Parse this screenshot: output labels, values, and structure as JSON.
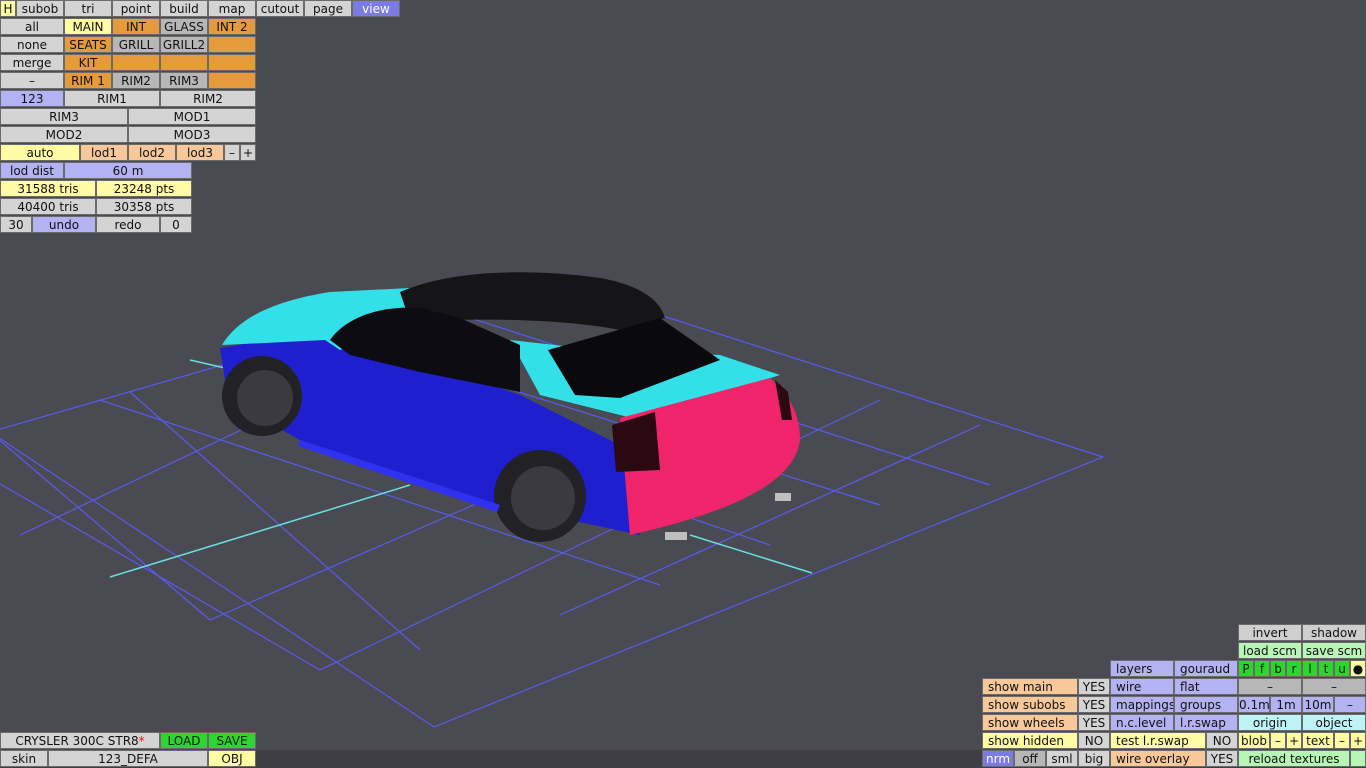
{
  "menu": {
    "h": "H",
    "subob": "subob",
    "tri": "tri",
    "point": "point",
    "build": "build",
    "map": "map",
    "cutout": "cutout",
    "page": "page",
    "view": "view"
  },
  "sel": {
    "all": "all",
    "none": "none",
    "merge": "merge",
    "minus": "–"
  },
  "parts": {
    "main": "MAIN",
    "int": "INT",
    "glass": "GLASS",
    "int2": "INT 2",
    "seats": "SEATS",
    "grill": "GRILL",
    "grill2": "GRILL2",
    "kit": "KIT",
    "rim1": "RIM 1",
    "rim2": "RIM2",
    "rim3": "RIM3"
  },
  "variants": {
    "num": "123",
    "rim1": "RIM1",
    "rim2": "RIM2",
    "rim3": "RIM3",
    "mod1": "MOD1",
    "mod2": "MOD2",
    "mod3": "MOD3"
  },
  "lod": {
    "auto": "auto",
    "lod1": "lod1",
    "lod2": "lod2",
    "lod3": "lod3",
    "minus": "–",
    "plus": "+",
    "dist_label": "lod dist",
    "dist_value": "60 m"
  },
  "stats": {
    "tris_a": "31588 tris",
    "pts_a": "23248 pts",
    "tris_b": "40400 tris",
    "pts_b": "30358 pts"
  },
  "history": {
    "count": "30",
    "undo": "undo",
    "redo": "redo",
    "redo_count": "0"
  },
  "file": {
    "name": "CRYSLER 300C STR8",
    "modified": "*",
    "load": "LOAD",
    "save": "SAVE",
    "skin": "skin",
    "skin_value": "123_DEFA",
    "obj": "OBJ"
  },
  "view": {
    "show_main": "show main",
    "show_main_val": "YES",
    "show_subobs": "show subobs",
    "show_subobs_val": "YES",
    "show_wheels": "show wheels",
    "show_wheels_val": "YES",
    "show_hidden": "show hidden",
    "show_hidden_val": "NO",
    "nrm": "nrm",
    "off": "off",
    "sml": "sml",
    "big": "big",
    "layers": "layers",
    "gouraud": "gouraud",
    "wire": "wire",
    "flat": "flat",
    "mappings": "mappings",
    "groups": "groups",
    "nclevel": "n.c.level",
    "lrswap": "l.r.swap",
    "test_lrswap": "test l.r.swap",
    "test_lrswap_val": "NO",
    "wire_overlay": "wire overlay",
    "wire_overlay_val": "YES",
    "invert": "invert",
    "shadow": "shadow",
    "load_scm": "load scm",
    "save_scm": "save scm",
    "letters": [
      "P",
      "f",
      "b",
      "r",
      "l",
      "t",
      "u",
      "●"
    ],
    "dash": "–",
    "g01": "0.1m",
    "g1": "1m",
    "g10": "10m",
    "origin": "origin",
    "object": "object",
    "blob": "blob",
    "text": "text",
    "minus": "–",
    "plus": "+",
    "reload": "reload textures"
  },
  "colors": {
    "background": "#4a4a52",
    "grid": "#6060ff",
    "grid_axis": "#66e0e0",
    "car_blue": "#1f1fd0",
    "car_cyan": "#33e0e8",
    "car_pink": "#f0246a",
    "wheel": "#222226"
  }
}
